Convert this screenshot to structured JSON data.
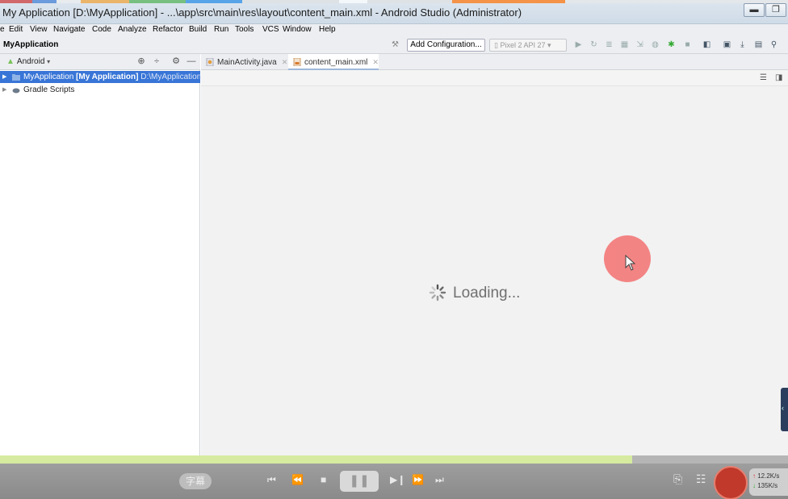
{
  "window": {
    "title": "My Application [D:\\MyApplication] - ...\\app\\src\\main\\res\\layout\\content_main.xml - Android Studio (Administrator)",
    "minimize": "▬",
    "maximize": "❐"
  },
  "menu": {
    "items": [
      {
        "label": "File",
        "shown": "e"
      },
      {
        "label": "Edit",
        "shown": "Edit"
      },
      {
        "label": "View",
        "shown": "View"
      },
      {
        "label": "Navigate",
        "shown": "Navigate"
      },
      {
        "label": "Code",
        "shown": "Code"
      },
      {
        "label": "Analyze",
        "shown": "Analyze"
      },
      {
        "label": "Refactor",
        "shown": "Refactor"
      },
      {
        "label": "Build",
        "shown": "Build"
      },
      {
        "label": "Run",
        "shown": "Run"
      },
      {
        "label": "Tools",
        "shown": "Tools"
      },
      {
        "label": "VCS",
        "shown": "VCS"
      },
      {
        "label": "Window",
        "shown": "Window"
      },
      {
        "label": "Help",
        "shown": "Help"
      }
    ]
  },
  "toolbar": {
    "project": "MyApplication",
    "add_configuration": "Add Configuration...",
    "device": "Pixel 2 API 27"
  },
  "project_pane": {
    "view": "Android",
    "tree": [
      {
        "label": "MyApplication",
        "module": "[My Application]",
        "path": "D:\\MyApplication"
      },
      {
        "label": "Gradle Scripts"
      }
    ]
  },
  "tabs": [
    {
      "label": "MainActivity.java",
      "active": false
    },
    {
      "label": "content_main.xml",
      "active": true
    }
  ],
  "editor": {
    "loading_text": "Loading..."
  },
  "player": {
    "subtitle": "字幕",
    "progress": 0.802,
    "upload_speed": "12.2K/s",
    "download_speed": "135K/s"
  },
  "colors": {
    "selection": "#3875d7",
    "cursor_highlight": "#f47b7b",
    "progress_fill": "#d6eba0"
  }
}
